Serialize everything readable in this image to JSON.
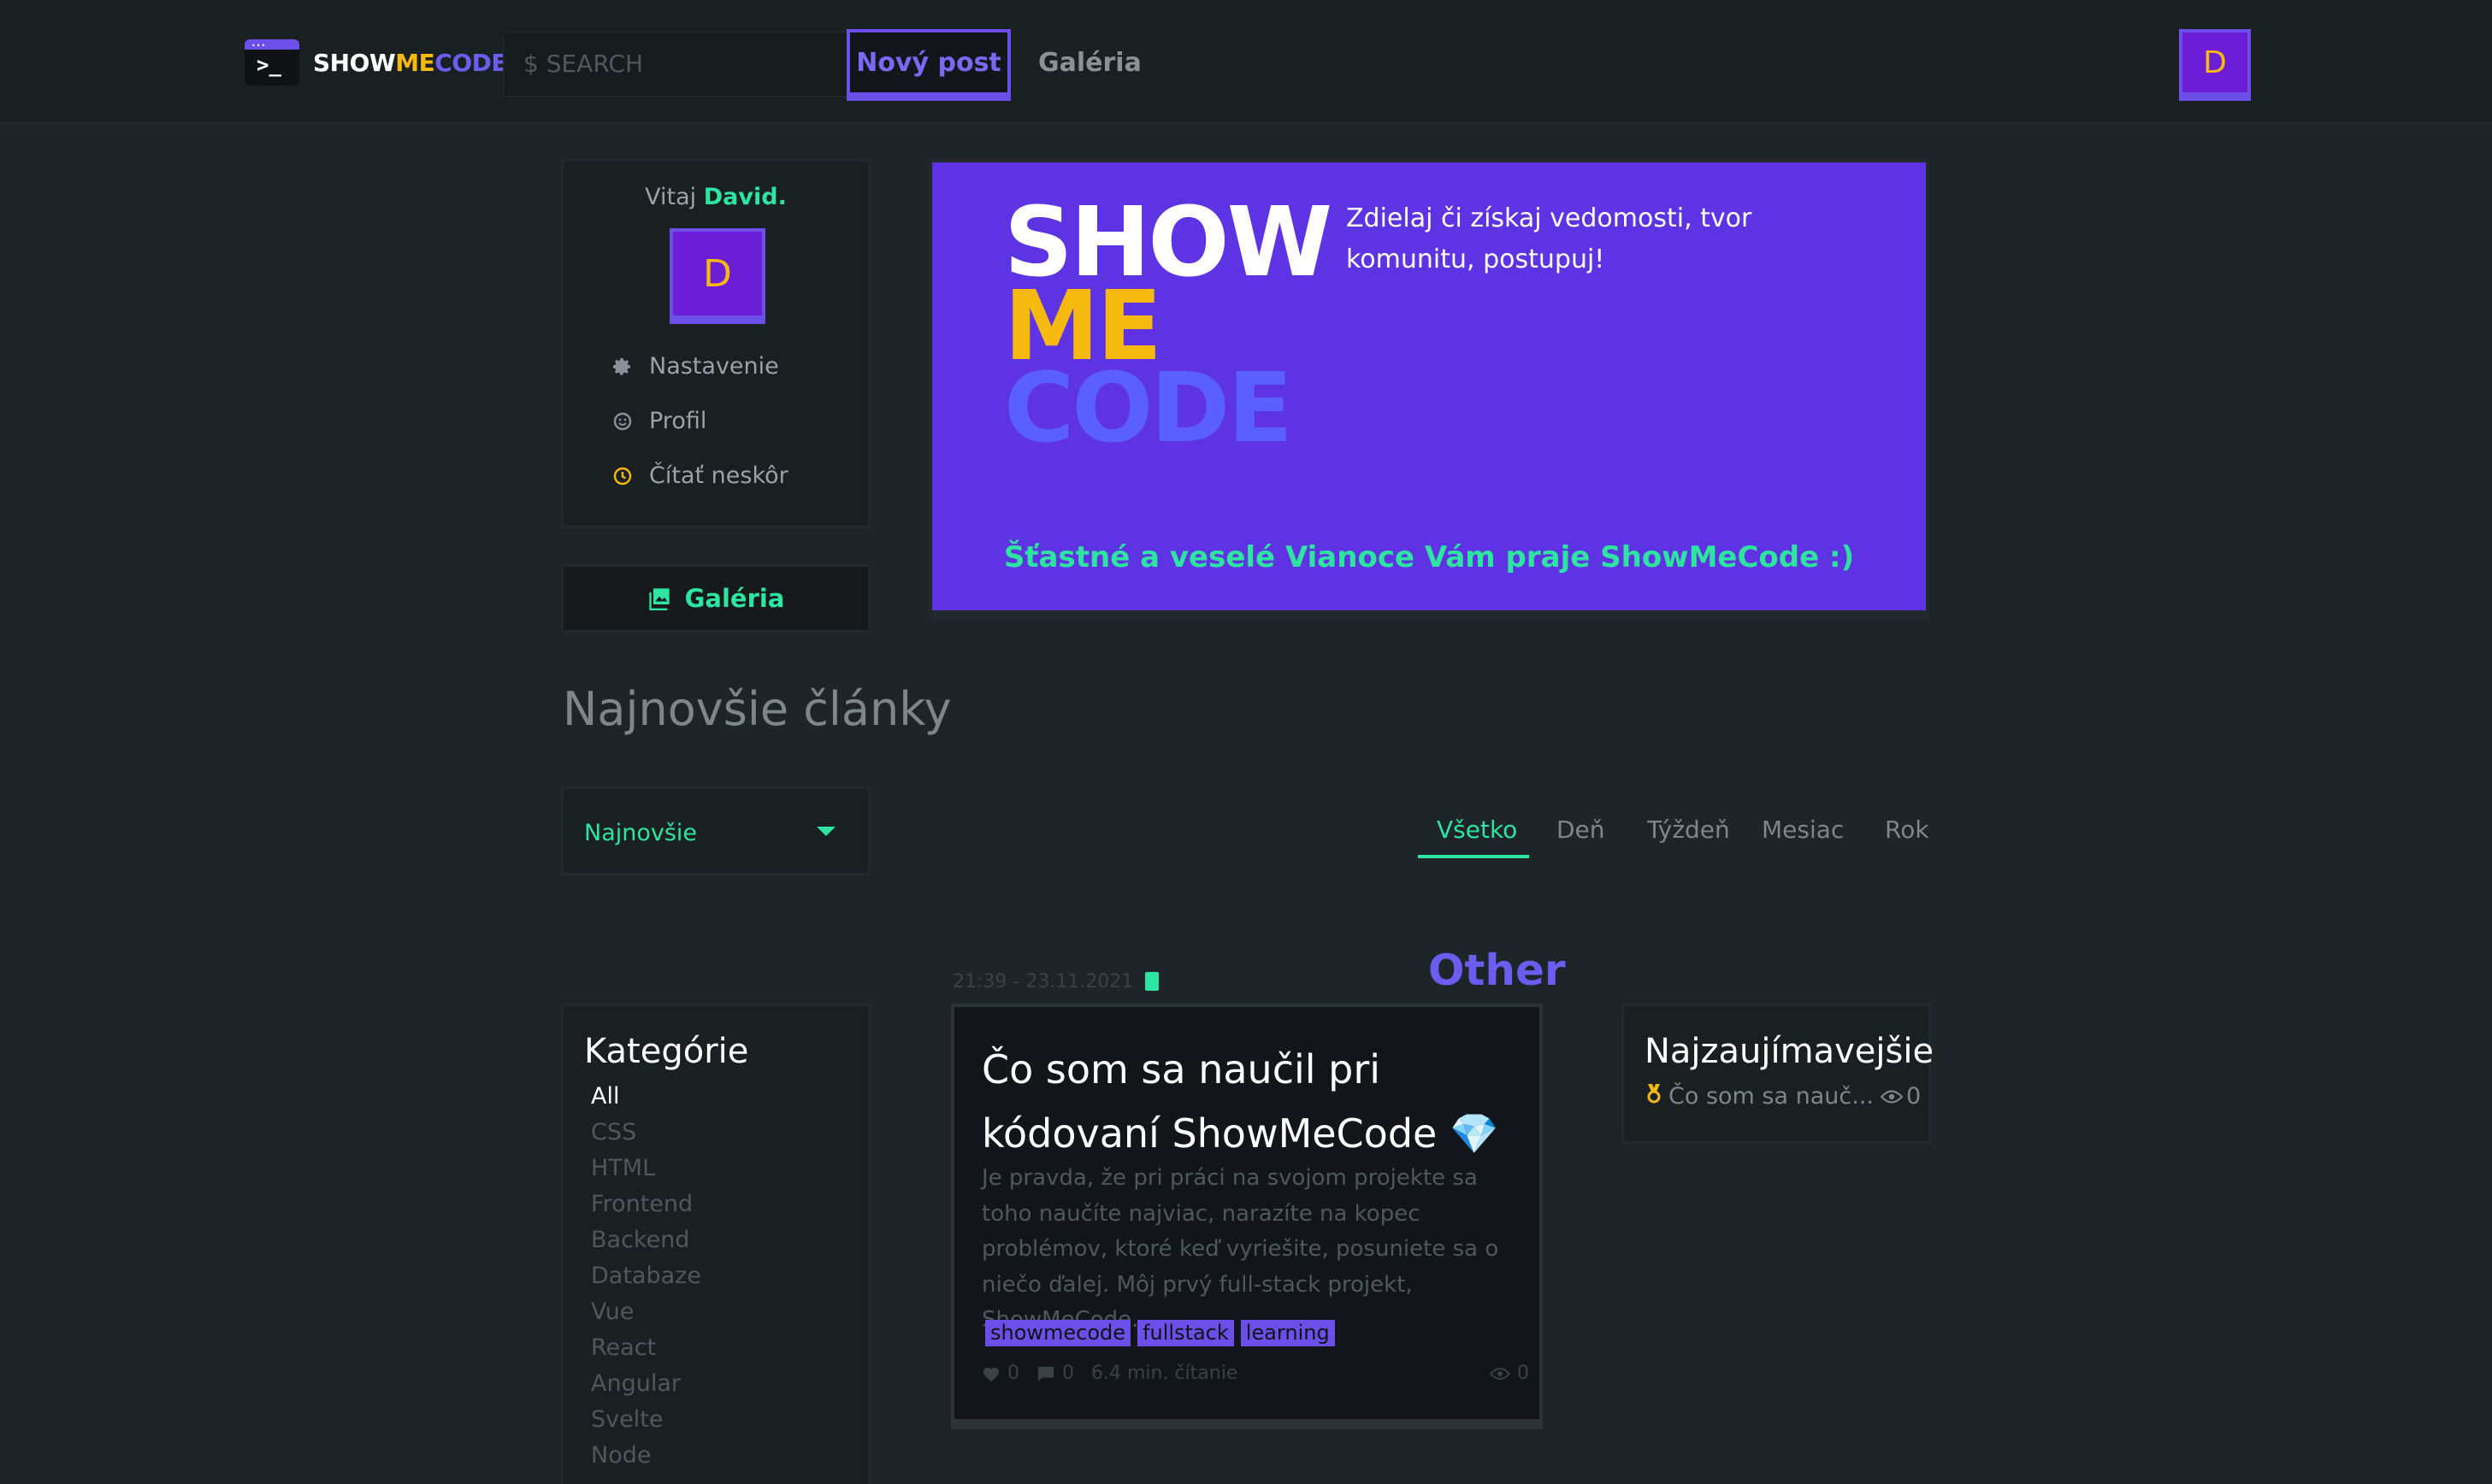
{
  "header": {
    "logo": {
      "part1": "SHOW",
      "part2": "ME",
      "part3": "CODE",
      "prompt": ">_"
    },
    "search_placeholder": "$ SEARCH",
    "new_post_label": "Nový post",
    "gallery_label": "Galéria",
    "avatar_letter": "D"
  },
  "profile": {
    "welcome_prefix": "Vitaj",
    "username": "David.",
    "avatar_letter": "D",
    "menu": [
      {
        "label": "Nastavenie",
        "icon": "gear-icon"
      },
      {
        "label": "Profil",
        "icon": "smiley-icon"
      },
      {
        "label": "Čítať neskôr",
        "icon": "clock-icon"
      }
    ]
  },
  "gallery_card": {
    "label": "Galéria",
    "icon": "image-gallery-icon"
  },
  "banner": {
    "line1": "SHOW",
    "line2": "ME",
    "line3": "CODE",
    "tagline": "Zdielaj či získaj vedomosti, tvor komunitu, postupuj!",
    "footer": "Šťastné a veselé Vianoce Vám praje ShowMeCode :)"
  },
  "section_title": "Najnovšie články",
  "sort": {
    "selected": "Najnovšie"
  },
  "time_tabs": {
    "items": [
      "Všetko",
      "Deň",
      "Týždeň",
      "Mesiac",
      "Rok"
    ],
    "active": "Všetko"
  },
  "categories": {
    "title": "Kategórie",
    "items": [
      "All",
      "CSS",
      "HTML",
      "Frontend",
      "Backend",
      "Databaze",
      "Vue",
      "React",
      "Angular",
      "Svelte",
      "Node"
    ],
    "active": "All"
  },
  "post": {
    "timestamp": "21:39 - 23.11.2021",
    "category": "Other",
    "title": "Čo som sa naučil pri kódovaní ShowMeCode",
    "title_emoji": "💎",
    "excerpt": "Je pravda, že pri práci na svojom projekte sa toho naučíte najviac, narazíte na kopec problémov, ktoré keď vyriešite, posuniete sa o niečo ďalej. Môj prvý full-stack projekt, ShowMeCode.",
    "tags": [
      "showmecode",
      "fullstack",
      "learning"
    ],
    "likes": "0",
    "comments": "0",
    "read_time": "6.4 min. čítanie",
    "views": "0"
  },
  "interesting": {
    "title": "Najzaujímavejšie",
    "item_title": "Čo som sa nauč...",
    "item_views": "0"
  },
  "colors": {
    "background": "#1e2427",
    "accent_purple": "#6b4fe8",
    "accent_green": "#2de4a0",
    "accent_yellow": "#f5b90f",
    "banner": "#5e33e3"
  }
}
